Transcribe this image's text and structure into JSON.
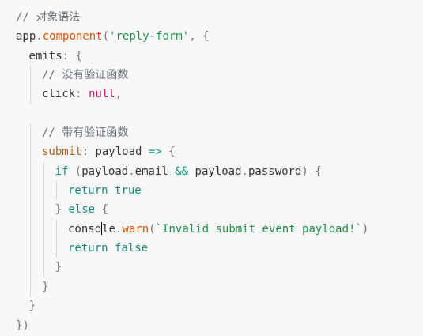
{
  "colors": {
    "background": "#f8f8f8",
    "comment": "#6a737d",
    "function": "#d35400",
    "string": "#1c8f4a",
    "keyword": "#1a8a7a",
    "literal": "#c41a6b",
    "property_key": "#b15e14"
  },
  "code": {
    "lines": [
      {
        "indent": 0,
        "tokens": [
          {
            "type": "comment",
            "text": "// 对象语法"
          }
        ]
      },
      {
        "indent": 0,
        "tokens": [
          {
            "type": "plain",
            "text": "app"
          },
          {
            "type": "punct",
            "text": "."
          },
          {
            "type": "fn",
            "text": "component"
          },
          {
            "type": "punct",
            "text": "("
          },
          {
            "type": "string",
            "text": "'reply-form'"
          },
          {
            "type": "punct",
            "text": ", {"
          }
        ]
      },
      {
        "indent": 1,
        "tokens": [
          {
            "type": "prop",
            "text": "emits"
          },
          {
            "type": "punct",
            "text": ": {"
          }
        ]
      },
      {
        "indent": 2,
        "tokens": [
          {
            "type": "comment",
            "text": "// 没有验证函数"
          }
        ]
      },
      {
        "indent": 2,
        "tokens": [
          {
            "type": "prop",
            "text": "click"
          },
          {
            "type": "punct",
            "text": ": "
          },
          {
            "type": "literal",
            "text": "null"
          },
          {
            "type": "punct",
            "text": ","
          }
        ]
      },
      {
        "indent": 0,
        "tokens": []
      },
      {
        "indent": 2,
        "tokens": [
          {
            "type": "comment",
            "text": "// 带有验证函数"
          }
        ]
      },
      {
        "indent": 2,
        "tokens": [
          {
            "type": "key",
            "text": "submit"
          },
          {
            "type": "punct",
            "text": ": "
          },
          {
            "type": "plain",
            "text": "payload "
          },
          {
            "type": "operator",
            "text": "=>"
          },
          {
            "type": "punct",
            "text": " {"
          }
        ]
      },
      {
        "indent": 3,
        "tokens": [
          {
            "type": "keyword",
            "text": "if"
          },
          {
            "type": "punct",
            "text": " ("
          },
          {
            "type": "plain",
            "text": "payload"
          },
          {
            "type": "punct",
            "text": "."
          },
          {
            "type": "plain",
            "text": "email "
          },
          {
            "type": "operator",
            "text": "&&"
          },
          {
            "type": "plain",
            "text": " payload"
          },
          {
            "type": "punct",
            "text": "."
          },
          {
            "type": "plain",
            "text": "password"
          },
          {
            "type": "punct",
            "text": ") {"
          }
        ]
      },
      {
        "indent": 4,
        "tokens": [
          {
            "type": "keyword",
            "text": "return"
          },
          {
            "type": "plain",
            "text": " "
          },
          {
            "type": "keyword",
            "text": "true"
          }
        ]
      },
      {
        "indent": 3,
        "tokens": [
          {
            "type": "punct",
            "text": "} "
          },
          {
            "type": "keyword",
            "text": "else"
          },
          {
            "type": "punct",
            "text": " {"
          }
        ]
      },
      {
        "indent": 4,
        "caret_after": 0,
        "tokens": [
          {
            "type": "plain",
            "text": "conso"
          },
          {
            "type": "plain",
            "text": "le"
          },
          {
            "type": "punct",
            "text": "."
          },
          {
            "type": "fn",
            "text": "warn"
          },
          {
            "type": "punct",
            "text": "("
          },
          {
            "type": "string",
            "text": "`Invalid submit event payload!`"
          },
          {
            "type": "punct",
            "text": ")"
          }
        ]
      },
      {
        "indent": 4,
        "tokens": [
          {
            "type": "keyword",
            "text": "return"
          },
          {
            "type": "plain",
            "text": " "
          },
          {
            "type": "keyword",
            "text": "false"
          }
        ]
      },
      {
        "indent": 3,
        "tokens": [
          {
            "type": "punct",
            "text": "}"
          }
        ]
      },
      {
        "indent": 2,
        "tokens": [
          {
            "type": "punct",
            "text": "}"
          }
        ]
      },
      {
        "indent": 1,
        "tokens": [
          {
            "type": "punct",
            "text": "}"
          }
        ]
      },
      {
        "indent": 0,
        "tokens": [
          {
            "type": "punct",
            "text": "})"
          }
        ]
      }
    ]
  }
}
